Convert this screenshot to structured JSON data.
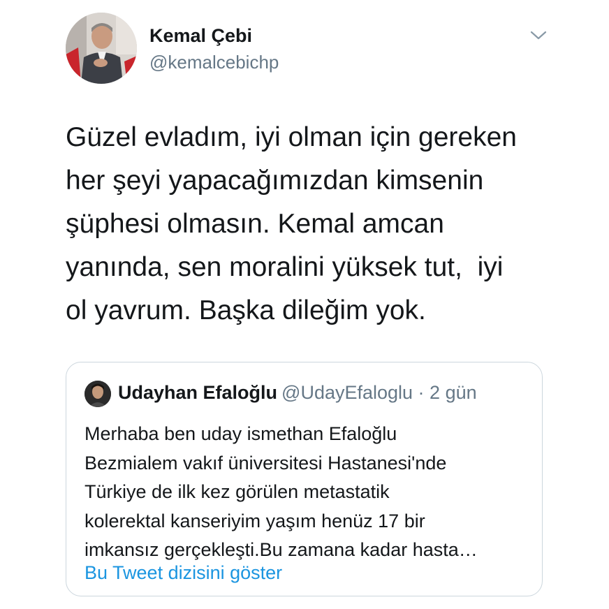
{
  "tweet": {
    "author": {
      "name": "Kemal Çebi",
      "handle": "@kemalcebichp",
      "avatar_icon": "profile-photo"
    },
    "menu_icon": "chevron-down-icon",
    "text_lines": [
      "Güzel evladım, iyi olman için gereken",
      "her şeyi yapacağımızdan kimsenin",
      "şüphesi olmasın. Kemal amcan",
      "yanında, sen moralini yüksek tut,  iyi",
      "ol yavrum. Başka dileğim yok."
    ]
  },
  "quoted_tweet": {
    "author_name": "Udayhan Efaloğlu",
    "handle": "@UdayEfaloglu",
    "separator": " · ",
    "time": "2 gün",
    "text_lines": [
      "Merhaba ben uday ismethan Efaloğlu",
      "Bezmialem vakıf üniversitesi Hastanesi'nde",
      "Türkiye de ilk kez görülen metastatik",
      "kolerektal kanseriyim yaşım henüz 17 bir",
      "imkansız gerçekleşti.Bu zamana kadar hasta…"
    ],
    "show_thread_label": "Bu Tweet dizisini göster"
  },
  "colors": {
    "text": "#14171a",
    "secondary": "#657786",
    "link": "#1b95e0",
    "border": "#ccd6dd"
  }
}
